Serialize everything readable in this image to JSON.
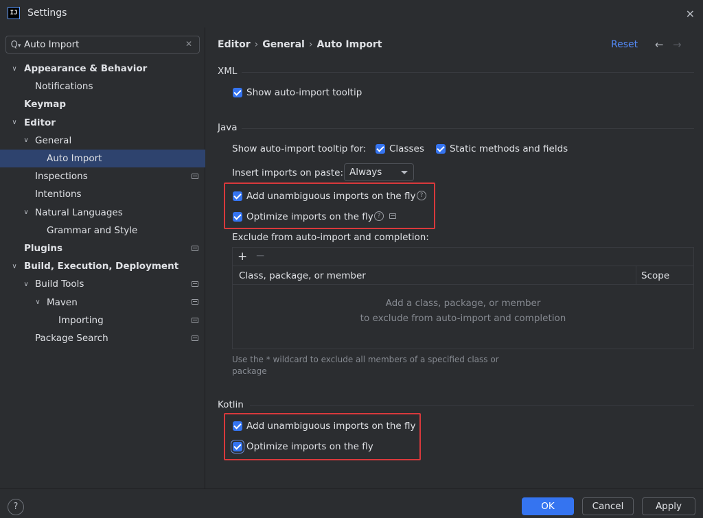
{
  "window": {
    "app_icon_text": "IJ",
    "title": "Settings",
    "close_icon": "close-icon"
  },
  "search": {
    "value": "Auto Import",
    "icon": "search-icon",
    "clear_icon": "clear-icon"
  },
  "sidebar": {
    "items": [
      {
        "label": "Appearance & Behavior",
        "expanded": true
      },
      {
        "label": "Notifications"
      },
      {
        "label": "Keymap"
      },
      {
        "label": "Editor",
        "expanded": true
      },
      {
        "label": "General",
        "expanded": true
      },
      {
        "label": "Auto Import",
        "selected": true
      },
      {
        "label": "Inspections",
        "project_scope": true
      },
      {
        "label": "Intentions"
      },
      {
        "label": "Natural Languages",
        "expanded": true
      },
      {
        "label": "Grammar and Style"
      },
      {
        "label": "Plugins",
        "project_scope": true
      },
      {
        "label": "Build, Execution, Deployment",
        "expanded": true
      },
      {
        "label": "Build Tools",
        "expanded": true,
        "project_scope": true
      },
      {
        "label": "Maven",
        "expanded": true,
        "project_scope": true
      },
      {
        "label": "Importing",
        "project_scope": true
      },
      {
        "label": "Package Search",
        "project_scope": true
      }
    ]
  },
  "breadcrumb": {
    "items": [
      "Editor",
      "General",
      "Auto Import"
    ],
    "separator": "›"
  },
  "header": {
    "reset_label": "Reset",
    "back_icon": "arrow-left-icon",
    "forward_icon": "arrow-right-icon"
  },
  "xml": {
    "title": "XML",
    "show_tooltip_label": "Show auto-import tooltip",
    "show_tooltip_checked": true
  },
  "java": {
    "title": "Java",
    "show_tooltip_for_label": "Show auto-import tooltip for:",
    "classes_label": "Classes",
    "classes_checked": true,
    "static_label": "Static methods and fields",
    "static_checked": true,
    "insert_on_paste_label": "Insert imports on paste:",
    "insert_on_paste_value": "Always",
    "add_unambiguous_label": "Add unambiguous imports on the fly",
    "add_unambiguous_checked": true,
    "optimize_label": "Optimize imports on the fly",
    "optimize_checked": true,
    "exclude_label": "Exclude from auto-import and completion:",
    "table": {
      "columns": [
        "Class, package, or member",
        "Scope"
      ],
      "empty_line1": "Add a class, package, or member",
      "empty_line2": "to exclude from auto-import and completion"
    },
    "hint": "Use the * wildcard to exclude all members of a specified class or package"
  },
  "kotlin": {
    "title": "Kotlin",
    "add_unambiguous_label": "Add unambiguous imports on the fly",
    "add_unambiguous_checked": true,
    "optimize_label": "Optimize imports on the fly",
    "optimize_checked": true
  },
  "footer": {
    "help_label": "?",
    "ok_label": "OK",
    "cancel_label": "Cancel",
    "apply_label": "Apply"
  },
  "colors": {
    "background": "#2b2d30",
    "accent": "#3574f0",
    "link": "#548af7",
    "selection": "#2e436e",
    "highlight_box": "#d9393c"
  }
}
